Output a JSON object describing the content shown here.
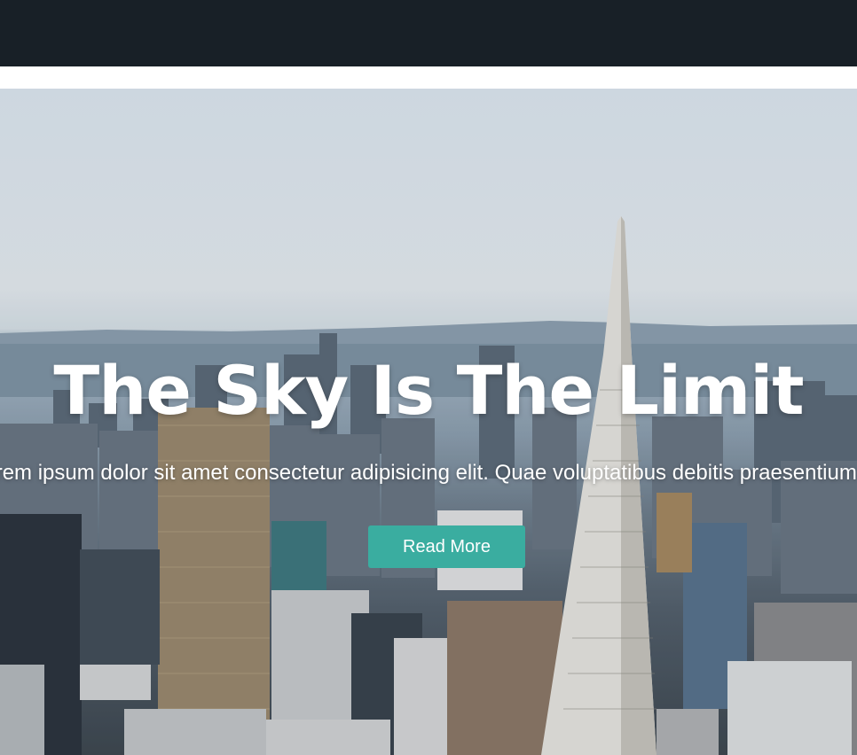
{
  "hero": {
    "title": "The Sky Is The Limit",
    "text": "Lorem ipsum dolor sit amet consectetur adipisicing elit. Quae voluptatibus debitis praesentium inventore",
    "button_label": "Read More",
    "colors": {
      "nav_background": "#182027",
      "button_background": "#3aada0",
      "text": "#ffffff"
    }
  }
}
